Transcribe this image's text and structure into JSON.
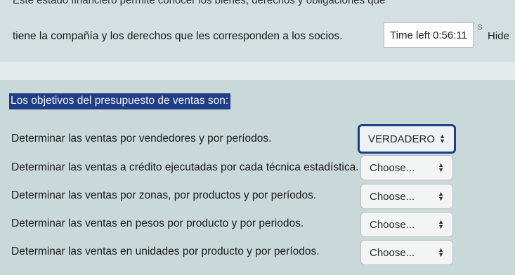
{
  "previous_question": {
    "cut_line": "Este estado financiero permite conocer los bienes, derechos y obligaciones que",
    "line": "tiene la compañía y los derechos que les corresponden a los socios."
  },
  "timer": {
    "label": "Time left",
    "value": "0:56:11"
  },
  "hide_label": "Hide",
  "question": {
    "title": "Los objetivos del presupuesto de ventas son:",
    "rows": [
      {
        "text": "Determinar las ventas por vendedores y por períodos.",
        "selected": "VERDADERO"
      },
      {
        "text": "Determinar las ventas a crédito ejecutadas por cada técnica estadística.",
        "selected": "Choose..."
      },
      {
        "text": "Determinar las ventas por zonas, por productos y por períodos.",
        "selected": "Choose..."
      },
      {
        "text": "Determinar las ventas en pesos por producto y por periodos.",
        "selected": "Choose..."
      },
      {
        "text": "Determinar las ventas en unidades por producto y por períodos.",
        "selected": "Choose..."
      }
    ]
  },
  "icons": {
    "select_caret": "up-down-caret-icon"
  },
  "colors": {
    "highlight": "#1f3e86",
    "background": "#c9d8d9"
  }
}
